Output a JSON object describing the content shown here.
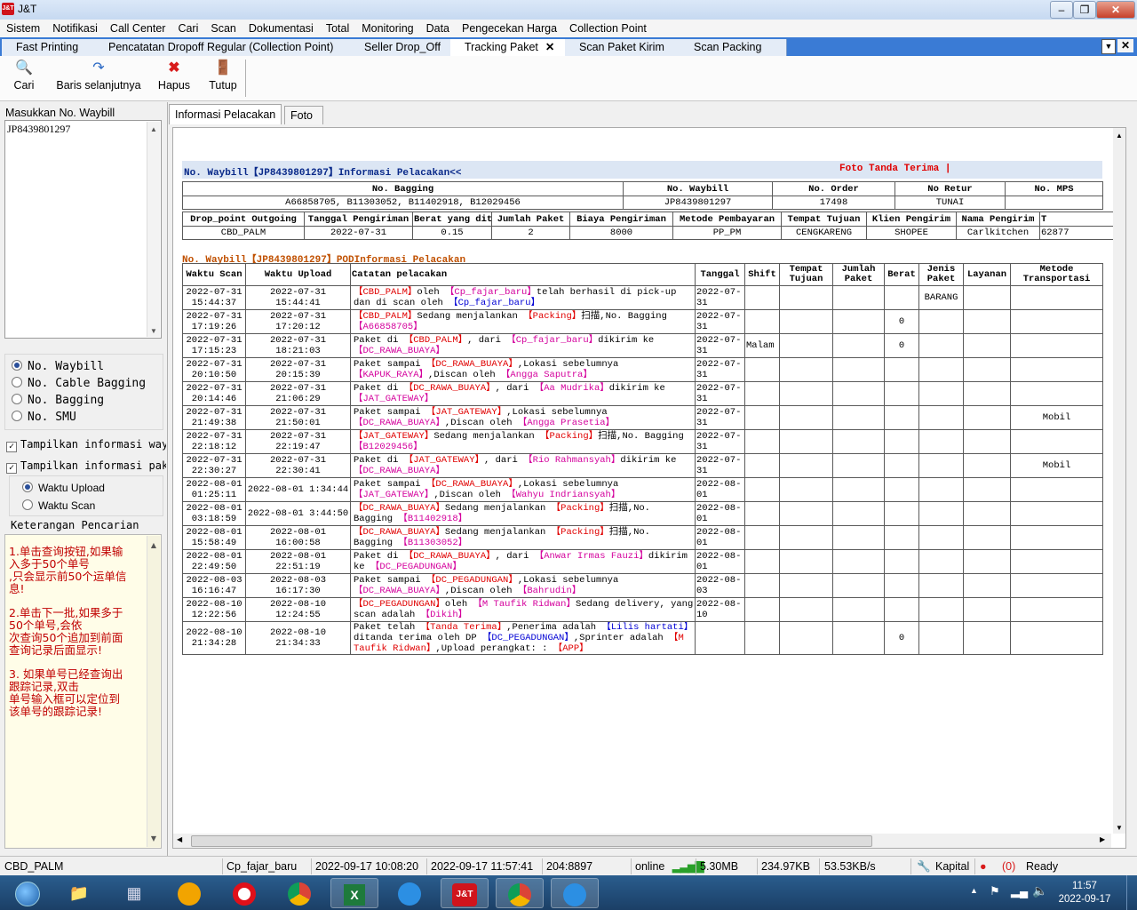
{
  "window": {
    "title": "J&T",
    "logo": "J&T"
  },
  "menu": [
    "Sistem",
    "Notifikasi",
    "Call Center",
    "Cari",
    "Scan",
    "Dokumentasi",
    "Total",
    "Monitoring",
    "Data",
    "Pengecekan Harga",
    "Collection Point"
  ],
  "tabs": [
    {
      "label": "Fast Printing"
    },
    {
      "label": "Pencatatan Dropoff Regular (Collection Point)"
    },
    {
      "label": "Seller Drop_Off"
    },
    {
      "label": "Tracking Paket",
      "active": true
    },
    {
      "label": "Scan Paket Kirim"
    },
    {
      "label": "Scan Packing"
    }
  ],
  "toolbar": [
    {
      "label": "Cari",
      "icon": "search-icon"
    },
    {
      "label": "Baris selanjutnya",
      "icon": "arrow-right-icon"
    },
    {
      "label": "Hapus",
      "icon": "delete-x-icon"
    },
    {
      "label": "Tutup",
      "icon": "exit-door-icon"
    }
  ],
  "left": {
    "waybill_label": "Masukkan No. Waybill",
    "waybill_value": "JP8439801297",
    "radios": [
      {
        "label": "No. Waybill",
        "checked": true
      },
      {
        "label": "No. Cable Bagging",
        "checked": false
      },
      {
        "label": "No. Bagging",
        "checked": false
      },
      {
        "label": "No. SMU",
        "checked": false
      }
    ],
    "checkboxes": [
      {
        "label": "Tampilkan informasi way",
        "checked": true
      },
      {
        "label": "Tampilkan informasi pak",
        "checked": true
      }
    ],
    "time_radios": [
      {
        "label": "Waktu Upload",
        "checked": true
      },
      {
        "label": "Waktu Scan",
        "checked": false
      }
    ],
    "tips_title": "Keterangan Pencarian",
    "tips": [
      "1.单击查询按钮,如果输\n入多于50个单号\n,只会显示前50个运单信\n息!",
      "2.单击下一批,如果多于\n50个单号,会依\n次查询50个追加到前面\n查询记录后面显示!",
      "3. 如果单号已经查询出\n跟踪记录,双击\n单号输入框可以定位到\n该单号的跟踪记录!"
    ]
  },
  "main_tabs": [
    "Informasi Pelacakan",
    "Foto"
  ],
  "info": {
    "header_left": "No. Waybill【JP8439801297】Informasi Pelacakan<<",
    "header_right": "Foto Tanda Terima |",
    "table1": {
      "headers": [
        "No. Bagging",
        "No. Waybill",
        "No. Order",
        "No Retur",
        "No. MPS"
      ],
      "values": [
        "A66858705, B11303052, B11402918, B12029456",
        "JP8439801297",
        "17498",
        "TUNAI",
        ""
      ]
    },
    "table2": {
      "headers": [
        "Drop_point Outgoing",
        "Tanggal Pengiriman",
        "Berat yang ditagih",
        "Jumlah Paket",
        "Biaya Pengiriman",
        "Metode Pembayaran",
        "Tempat Tujuan",
        "Klien Pengirim",
        "Nama Pengirim",
        "T"
      ],
      "values": [
        "CBD_PALM",
        "2022-07-31",
        "0.15",
        "2",
        "8000",
        "PP_PM",
        "CENGKARENG",
        "SHOPEE",
        "Carlkitchen",
        "62877"
      ]
    },
    "pod_title": "No. Waybill【JP8439801297】PODInformasi Pelacakan"
  },
  "track_headers": [
    "Waktu Scan",
    "Waktu Upload",
    "Catatan pelacakan",
    "Tanggal",
    "Shift",
    "Tempat Tujuan",
    "Jumlah Paket",
    "Berat",
    "Jenis Paket",
    "Layanan",
    "Metode Transportasi"
  ],
  "track_rows": [
    {
      "scan": "2022-07-31 15:44:37",
      "upload": "2022-07-31 15:44:41",
      "tanggal": "2022-07-31",
      "shift": "",
      "tujuan": "",
      "jumlah": "",
      "berat": "",
      "jenis": "BARANG",
      "layanan": "",
      "metode": "",
      "note": [
        [
          "red",
          "【CBD_PALM】"
        ],
        [
          "",
          "oleh "
        ],
        [
          "mag",
          "【Cp_fajar_baru】"
        ],
        [
          "",
          "telah berhasil di pick-up dan di scan oleh "
        ],
        [
          "blu",
          "【Cp_fajar_baru】"
        ]
      ]
    },
    {
      "scan": "2022-07-31 17:19:26",
      "upload": "2022-07-31 17:20:12",
      "tanggal": "2022-07-31",
      "shift": "",
      "tujuan": "",
      "jumlah": "",
      "berat": "0",
      "jenis": "",
      "layanan": "",
      "metode": "",
      "note": [
        [
          "red",
          "【CBD_PALM】"
        ],
        [
          "",
          "Sedang menjalankan "
        ],
        [
          "red",
          "【Packing】"
        ],
        [
          "",
          "扫描,No. Bagging "
        ],
        [
          "mag",
          "【A66858705】"
        ]
      ]
    },
    {
      "scan": "2022-07-31 17:15:23",
      "upload": "2022-07-31 18:21:03",
      "tanggal": "2022-07-31",
      "shift": "Malam",
      "tujuan": "",
      "jumlah": "",
      "berat": "0",
      "jenis": "",
      "layanan": "",
      "metode": "",
      "note": [
        [
          "",
          "Paket di "
        ],
        [
          "red",
          "【CBD_PALM】"
        ],
        [
          "",
          ", dari "
        ],
        [
          "mag",
          "【Cp_fajar_baru】"
        ],
        [
          "",
          "dikirim ke "
        ],
        [
          "mag",
          "【DC_RAWA_BUAYA】"
        ]
      ]
    },
    {
      "scan": "2022-07-31 20:10:50",
      "upload": "2022-07-31 20:15:39",
      "tanggal": "2022-07-31",
      "shift": "",
      "tujuan": "",
      "jumlah": "",
      "berat": "",
      "jenis": "",
      "layanan": "",
      "metode": "",
      "note": [
        [
          "",
          "Paket sampai "
        ],
        [
          "red",
          "【DC_RAWA_BUAYA】"
        ],
        [
          "",
          ",Lokasi sebelumnya "
        ],
        [
          "mag",
          "【KAPUK_RAYA】"
        ],
        [
          "",
          ",Discan oleh "
        ],
        [
          "mag",
          "【Angga Saputra】"
        ]
      ]
    },
    {
      "scan": "2022-07-31 20:14:46",
      "upload": "2022-07-31 21:06:29",
      "tanggal": "2022-07-31",
      "shift": "",
      "tujuan": "",
      "jumlah": "",
      "berat": "",
      "jenis": "",
      "layanan": "",
      "metode": "",
      "note": [
        [
          "",
          "Paket di "
        ],
        [
          "red",
          "【DC_RAWA_BUAYA】"
        ],
        [
          "",
          ", dari "
        ],
        [
          "mag",
          "【Aa Mudrika】"
        ],
        [
          "",
          "dikirim ke "
        ],
        [
          "mag",
          "【JAT_GATEWAY】"
        ]
      ]
    },
    {
      "scan": "2022-07-31 21:49:38",
      "upload": "2022-07-31 21:50:01",
      "tanggal": "2022-07-31",
      "shift": "",
      "tujuan": "",
      "jumlah": "",
      "berat": "",
      "jenis": "",
      "layanan": "",
      "metode": "Mobil",
      "note": [
        [
          "",
          "Paket sampai "
        ],
        [
          "red",
          "【JAT_GATEWAY】"
        ],
        [
          "",
          ",Lokasi sebelumnya "
        ],
        [
          "mag",
          "【DC_RAWA_BUAYA】"
        ],
        [
          "",
          ",Discan oleh "
        ],
        [
          "mag",
          "【Angga Prasetia】"
        ]
      ]
    },
    {
      "scan": "2022-07-31 22:18:12",
      "upload": "2022-07-31 22:19:47",
      "tanggal": "2022-07-31",
      "shift": "",
      "tujuan": "",
      "jumlah": "",
      "berat": "",
      "jenis": "",
      "layanan": "",
      "metode": "",
      "note": [
        [
          "red",
          "【JAT_GATEWAY】"
        ],
        [
          "",
          "Sedang menjalankan "
        ],
        [
          "red",
          "【Packing】"
        ],
        [
          "",
          "扫描,No. Bagging "
        ],
        [
          "mag",
          "【B12029456】"
        ]
      ]
    },
    {
      "scan": "2022-07-31 22:30:27",
      "upload": "2022-07-31 22:30:41",
      "tanggal": "2022-07-31",
      "shift": "",
      "tujuan": "",
      "jumlah": "",
      "berat": "",
      "jenis": "",
      "layanan": "",
      "metode": "Mobil",
      "note": [
        [
          "",
          "Paket di "
        ],
        [
          "red",
          "【JAT_GATEWAY】"
        ],
        [
          "",
          ", dari "
        ],
        [
          "mag",
          "【Rio Rahmansyah】"
        ],
        [
          "",
          "dikirim ke "
        ],
        [
          "mag",
          "【DC_RAWA_BUAYA】"
        ]
      ]
    },
    {
      "scan": "2022-08-01 01:25:11",
      "upload": "2022-08-01 1:34:44",
      "tanggal": "2022-08-01",
      "shift": "",
      "tujuan": "",
      "jumlah": "",
      "berat": "",
      "jenis": "",
      "layanan": "",
      "metode": "",
      "note": [
        [
          "",
          "Paket sampai "
        ],
        [
          "red",
          "【DC_RAWA_BUAYA】"
        ],
        [
          "",
          ",Lokasi sebelumnya "
        ],
        [
          "mag",
          "【JAT_GATEWAY】"
        ],
        [
          "",
          ",Discan oleh "
        ],
        [
          "mag",
          "【Wahyu Indriansyah】"
        ]
      ]
    },
    {
      "scan": "2022-08-01 03:18:59",
      "upload": "2022-08-01 3:44:50",
      "tanggal": "2022-08-01",
      "shift": "",
      "tujuan": "",
      "jumlah": "",
      "berat": "",
      "jenis": "",
      "layanan": "",
      "metode": "",
      "note": [
        [
          "red",
          "【DC_RAWA_BUAYA】"
        ],
        [
          "",
          "Sedang menjalankan "
        ],
        [
          "red",
          "【Packing】"
        ],
        [
          "",
          "扫描,No. Bagging "
        ],
        [
          "mag",
          "【B11402918】"
        ]
      ]
    },
    {
      "scan": "2022-08-01 15:58:49",
      "upload": "2022-08-01 16:00:58",
      "tanggal": "2022-08-01",
      "shift": "",
      "tujuan": "",
      "jumlah": "",
      "berat": "",
      "jenis": "",
      "layanan": "",
      "metode": "",
      "note": [
        [
          "red",
          "【DC_RAWA_BUAYA】"
        ],
        [
          "",
          "Sedang menjalankan "
        ],
        [
          "red",
          "【Packing】"
        ],
        [
          "",
          "扫描,No. Bagging "
        ],
        [
          "mag",
          "【B11303052】"
        ]
      ]
    },
    {
      "scan": "2022-08-01 22:49:50",
      "upload": "2022-08-01 22:51:19",
      "tanggal": "2022-08-01",
      "shift": "",
      "tujuan": "",
      "jumlah": "",
      "berat": "",
      "jenis": "",
      "layanan": "",
      "metode": "",
      "note": [
        [
          "",
          "Paket di "
        ],
        [
          "red",
          "【DC_RAWA_BUAYA】"
        ],
        [
          "",
          ", dari "
        ],
        [
          "mag",
          "【Anwar Irmas Fauzi】"
        ],
        [
          "",
          "dikirim ke "
        ],
        [
          "mag",
          "【DC_PEGADUNGAN】"
        ]
      ]
    },
    {
      "scan": "2022-08-03 16:16:47",
      "upload": "2022-08-03 16:17:30",
      "tanggal": "2022-08-03",
      "shift": "",
      "tujuan": "",
      "jumlah": "",
      "berat": "",
      "jenis": "",
      "layanan": "",
      "metode": "",
      "note": [
        [
          "",
          "Paket sampai "
        ],
        [
          "red",
          "【DC_PEGADUNGAN】"
        ],
        [
          "",
          ",Lokasi sebelumnya "
        ],
        [
          "mag",
          "【DC_RAWA_BUAYA】"
        ],
        [
          "",
          ",Discan oleh "
        ],
        [
          "mag",
          "【Bahrudin】"
        ]
      ]
    },
    {
      "scan": "2022-08-10 12:22:56",
      "upload": "2022-08-10 12:24:55",
      "tanggal": "2022-08-10",
      "shift": "",
      "tujuan": "",
      "jumlah": "",
      "berat": "",
      "jenis": "",
      "layanan": "",
      "metode": "",
      "note": [
        [
          "red",
          "【DC_PEGADUNGAN】"
        ],
        [
          "",
          "oleh "
        ],
        [
          "mag",
          "【M Taufik Ridwan】"
        ],
        [
          "",
          "Sedang delivery, yang scan adalah "
        ],
        [
          "mag",
          "【Dikih】"
        ]
      ]
    },
    {
      "scan": "2022-08-10 21:34:28",
      "upload": "2022-08-10 21:34:33",
      "tanggal": "",
      "shift": "",
      "tujuan": "",
      "jumlah": "",
      "berat": "0",
      "jenis": "",
      "layanan": "",
      "metode": "",
      "note": [
        [
          "",
          "Paket telah "
        ],
        [
          "red",
          "【Tanda Terima】"
        ],
        [
          "",
          ",Penerima adalah "
        ],
        [
          "blu",
          "【Lilis hartati】"
        ],
        [
          "",
          "ditanda terima oleh DP "
        ],
        [
          "blu",
          "【DC_PEGADUNGAN】"
        ],
        [
          "",
          ",Sprinter adalah "
        ],
        [
          "red",
          "【M Taufik Ridwan】"
        ],
        [
          "",
          ",Upload perangkat: : "
        ],
        [
          "red",
          "【APP】"
        ]
      ]
    }
  ],
  "status": {
    "site": "CBD_PALM",
    "user": "Cp_fajar_baru",
    "login_time": "2022-09-17 10:08:20",
    "now": "2022-09-17 11:57:41",
    "port": "204:8897",
    "online": "online",
    "mem": "5.30MB",
    "data": "234.97KB",
    "speed": "53.53KB/s",
    "kapital": "Kapital",
    "alerts": "(0)",
    "ready": "Ready"
  },
  "taskbar": {
    "clock_time": "11:57",
    "clock_date": "2022-09-17",
    "apps": [
      "file-explorer-icon",
      "calculator-icon",
      "security-shield-icon",
      "opera-browser-icon",
      "chrome-browser-icon",
      "excel-icon",
      "messenger-icon",
      "jnt-app-icon",
      "chrome-alt-icon",
      "messenger-alt-icon"
    ]
  },
  "colors": {
    "tabbar": "#3a7bd5",
    "note_red": "#e00000",
    "note_magenta": "#d4009c",
    "note_blue": "#0000d4",
    "header_bg": "#dce6f4"
  }
}
